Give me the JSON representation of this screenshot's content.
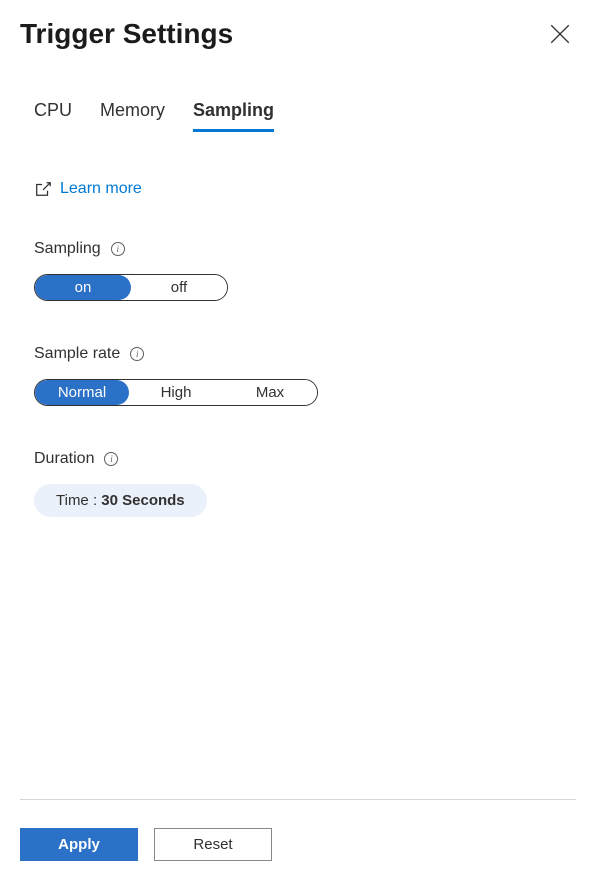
{
  "header": {
    "title": "Trigger Settings"
  },
  "tabs": {
    "items": [
      {
        "label": "CPU",
        "active": false
      },
      {
        "label": "Memory",
        "active": false
      },
      {
        "label": "Sampling",
        "active": true
      }
    ]
  },
  "learnMore": {
    "label": "Learn more"
  },
  "sampling": {
    "label": "Sampling",
    "options": {
      "on": "on",
      "off": "off"
    },
    "selected": "on"
  },
  "sampleRate": {
    "label": "Sample rate",
    "options": {
      "normal": "Normal",
      "high": "High",
      "max": "Max"
    },
    "selected": "Normal"
  },
  "duration": {
    "label": "Duration",
    "prefix": "Time : ",
    "value": "30 Seconds"
  },
  "footer": {
    "apply": "Apply",
    "reset": "Reset"
  }
}
